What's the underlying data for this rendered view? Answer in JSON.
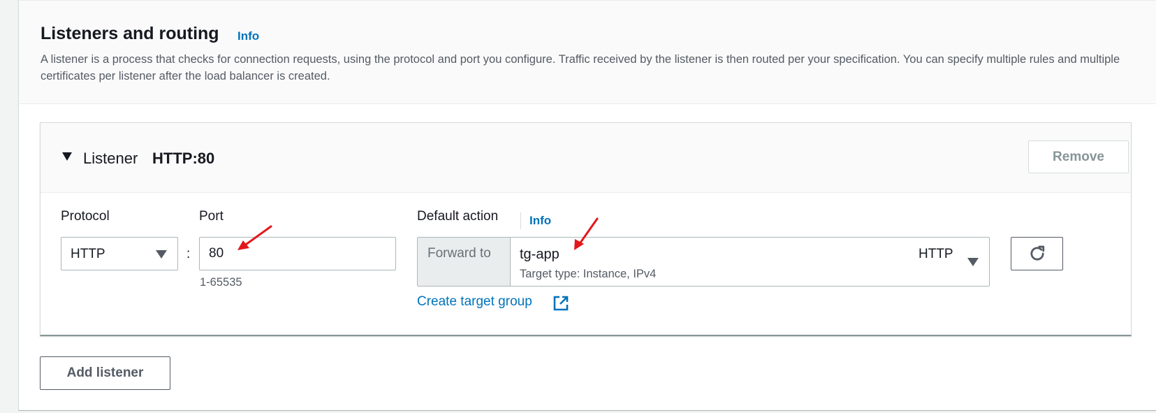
{
  "section": {
    "title": "Listeners and routing",
    "info_label": "Info",
    "description": "A listener is a process that checks for connection requests, using the protocol and port you configure. Traffic received by the listener is then routed per your specification. You can specify multiple rules and multiple certificates per listener after the load balancer is created."
  },
  "listener": {
    "label": "Listener",
    "value": "HTTP:80",
    "remove_label": "Remove",
    "protocol": {
      "label": "Protocol",
      "selected": "HTTP"
    },
    "separator": ":",
    "port": {
      "label": "Port",
      "value": "80",
      "hint": "1-65535"
    },
    "default_action": {
      "label": "Default action",
      "info_label": "Info",
      "forward_label": "Forward to",
      "target_group_name": "tg-app",
      "target_type": "Target type: Instance, IPv4",
      "target_protocol": "HTTP",
      "create_link": "Create target group"
    }
  },
  "add_listener_label": "Add listener",
  "colors": {
    "link": "#0073bb",
    "annotation_arrow": "#e3171b",
    "text": "#16191f",
    "muted": "#545b64"
  },
  "icons": {
    "expand": "caret-down-icon",
    "dropdown": "triangle-down-icon",
    "refresh": "refresh-icon",
    "external": "external-link-icon"
  }
}
